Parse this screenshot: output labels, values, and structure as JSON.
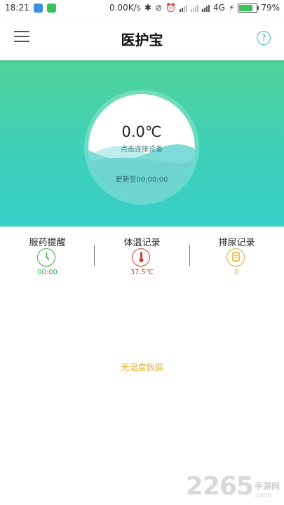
{
  "status_bar": {
    "time": "18:21",
    "network_speed": "0.00K/s",
    "network_type": "4G",
    "battery": "79%",
    "battery_level": 0.79
  },
  "app_bar": {
    "title": "医护宝",
    "menu_icon": "menu-icon",
    "help_icon": "help-icon",
    "help_glyph": "?"
  },
  "gauge": {
    "temperature": "0.0℃",
    "connect_hint": "点击连接设备",
    "update_time": "更新至00:00:00"
  },
  "quick_actions": [
    {
      "label": "服药提醒",
      "value": "00:00",
      "icon": "clock-icon",
      "color": "#3aa84a"
    },
    {
      "label": "体温记录",
      "value": "37.5℃",
      "icon": "thermometer-icon",
      "color": "#c9412d"
    },
    {
      "label": "排尿记录",
      "value": "0",
      "icon": "note-icon",
      "color": "#e0b22b"
    }
  ],
  "empty_state": "无温度数据",
  "watermark": {
    "number": "2265",
    "site": "手游网",
    "domain": ".com"
  },
  "colors": {
    "hero_top": "#4fd39a",
    "hero_bottom": "#38cfc9",
    "accent": "#3ab8a8"
  }
}
